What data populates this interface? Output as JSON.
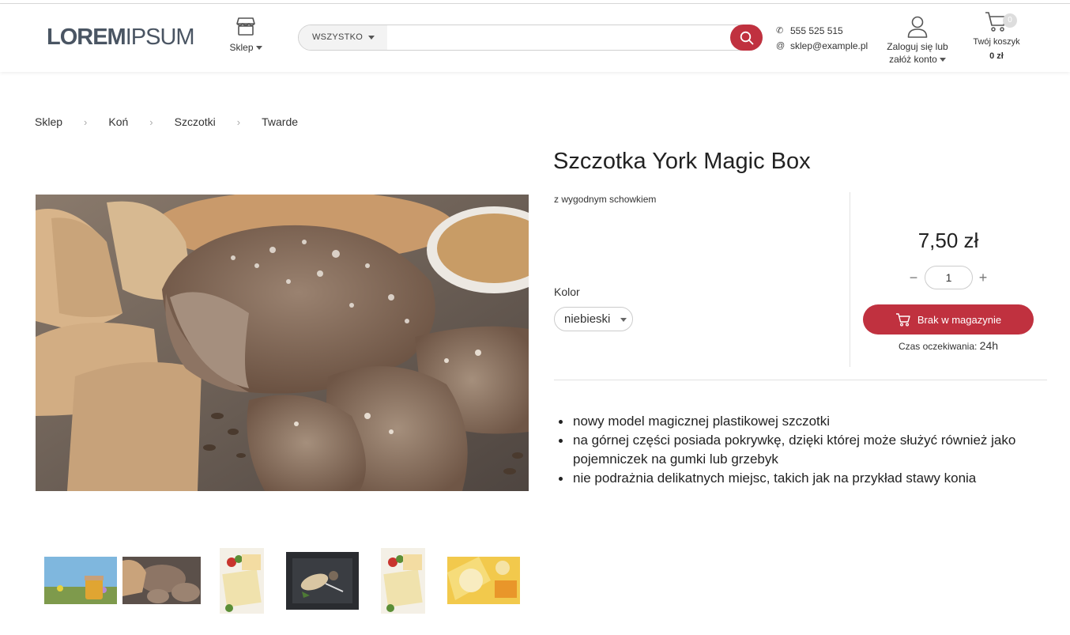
{
  "header": {
    "logo_bold": "LOREM",
    "logo_light": "IPSUM",
    "shop_menu_label": "Sklep",
    "search": {
      "category": "WSZYSTKO",
      "placeholder": ""
    },
    "phone": "555 525 515",
    "email": "sklep@example.pl",
    "account_line1": "Zaloguj się lub",
    "account_line2": "załóż konto",
    "cart_label": "Twój koszyk",
    "cart_total": "0 zł",
    "cart_count": "0"
  },
  "breadcrumb": [
    "Sklep",
    "Koń",
    "Szczotki",
    "Twarde"
  ],
  "product": {
    "title": "Szczotka York Magic Box",
    "subtitle": "z wygodnym schowkiem",
    "color_label": "Kolor",
    "color_value": "niebieski",
    "price": "7,50 zł",
    "quantity": "1",
    "add_button": "Brak w magazynie",
    "wait_label": "Czas oczekiwania:",
    "wait_value": "24h",
    "features": [
      "nowy model magicznej plastikowej szczotki",
      "na górnej części posiada pokrywkę, dzięki której może służyć również jako pojemniczek na gumki lub grzebyk",
      "nie podrażnia delikatnych miejsc, takich jak na przykład stawy konia"
    ]
  },
  "colors": {
    "accent": "#c0313f",
    "logo": "#4a5563"
  },
  "icons": [
    "shop-icon",
    "search-icon",
    "phone-icon",
    "at-icon",
    "user-icon",
    "cart-icon"
  ]
}
